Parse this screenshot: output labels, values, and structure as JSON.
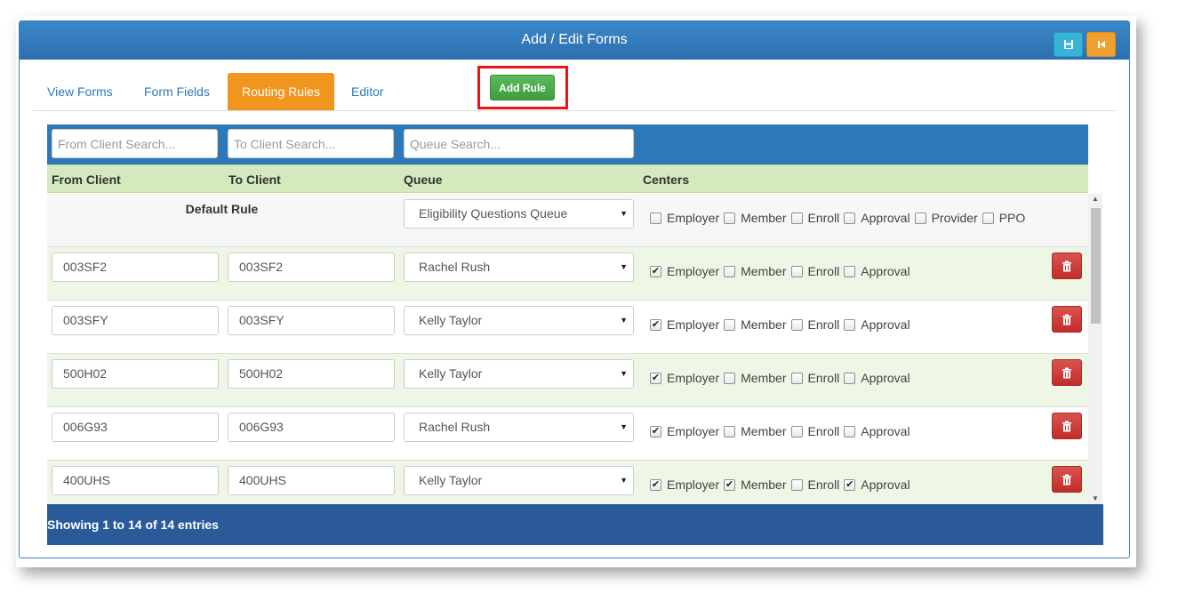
{
  "window": {
    "title": "Add / Edit Forms"
  },
  "toolbar": {
    "save_icon": "save-icon",
    "back_icon": "skip-back-icon"
  },
  "tabs": [
    {
      "label": "View Forms",
      "active": false
    },
    {
      "label": "Form Fields",
      "active": false
    },
    {
      "label": "Routing Rules",
      "active": true
    },
    {
      "label": "Editor",
      "active": false
    }
  ],
  "add_rule": {
    "label": "Add Rule"
  },
  "search": {
    "from_client_placeholder": "From Client Search...",
    "to_client_placeholder": "To Client Search...",
    "queue_placeholder": "Queue Search..."
  },
  "columns": {
    "from_client": "From Client",
    "to_client": "To Client",
    "queue": "Queue",
    "centers": "Centers"
  },
  "default_rule": {
    "label": "Default Rule",
    "queue": "Eligibility Questions Queue",
    "centers": [
      {
        "label": "Employer",
        "checked": false
      },
      {
        "label": "Member",
        "checked": false
      },
      {
        "label": "Enroll",
        "checked": false
      },
      {
        "label": "Approval",
        "checked": false
      },
      {
        "label": "Provider",
        "checked": false
      },
      {
        "label": "PPO",
        "checked": false
      }
    ]
  },
  "rules": [
    {
      "from": "003SF2",
      "to": "003SF2",
      "queue": "Rachel Rush",
      "centers": [
        {
          "label": "Employer",
          "checked": true
        },
        {
          "label": "Member",
          "checked": false
        },
        {
          "label": "Enroll",
          "checked": false
        },
        {
          "label": "Approval",
          "checked": false
        }
      ]
    },
    {
      "from": "003SFY",
      "to": "003SFY",
      "queue": "Kelly Taylor",
      "centers": [
        {
          "label": "Employer",
          "checked": true
        },
        {
          "label": "Member",
          "checked": false
        },
        {
          "label": "Enroll",
          "checked": false
        },
        {
          "label": "Approval",
          "checked": false
        }
      ]
    },
    {
      "from": "500H02",
      "to": "500H02",
      "queue": "Kelly Taylor",
      "centers": [
        {
          "label": "Employer",
          "checked": true
        },
        {
          "label": "Member",
          "checked": false
        },
        {
          "label": "Enroll",
          "checked": false
        },
        {
          "label": "Approval",
          "checked": false
        }
      ]
    },
    {
      "from": "006G93",
      "to": "006G93",
      "queue": "Rachel Rush",
      "centers": [
        {
          "label": "Employer",
          "checked": true
        },
        {
          "label": "Member",
          "checked": false
        },
        {
          "label": "Enroll",
          "checked": false
        },
        {
          "label": "Approval",
          "checked": false
        }
      ]
    },
    {
      "from": "400UHS",
      "to": "400UHS",
      "queue": "Kelly Taylor",
      "centers": [
        {
          "label": "Employer",
          "checked": true
        },
        {
          "label": "Member",
          "checked": true
        },
        {
          "label": "Enroll",
          "checked": false
        },
        {
          "label": "Approval",
          "checked": true
        }
      ]
    }
  ],
  "footer": {
    "info": "Showing 1 to 14 of 14 entries"
  },
  "colors": {
    "titlebar": "#2c6faf",
    "active_tab": "#f0961e",
    "add_rule": "#4cae4c",
    "highlight_frame": "#e8141a",
    "header_row": "#d4e9bd",
    "delete": "#d9534f",
    "footer": "#2b5a9b"
  }
}
